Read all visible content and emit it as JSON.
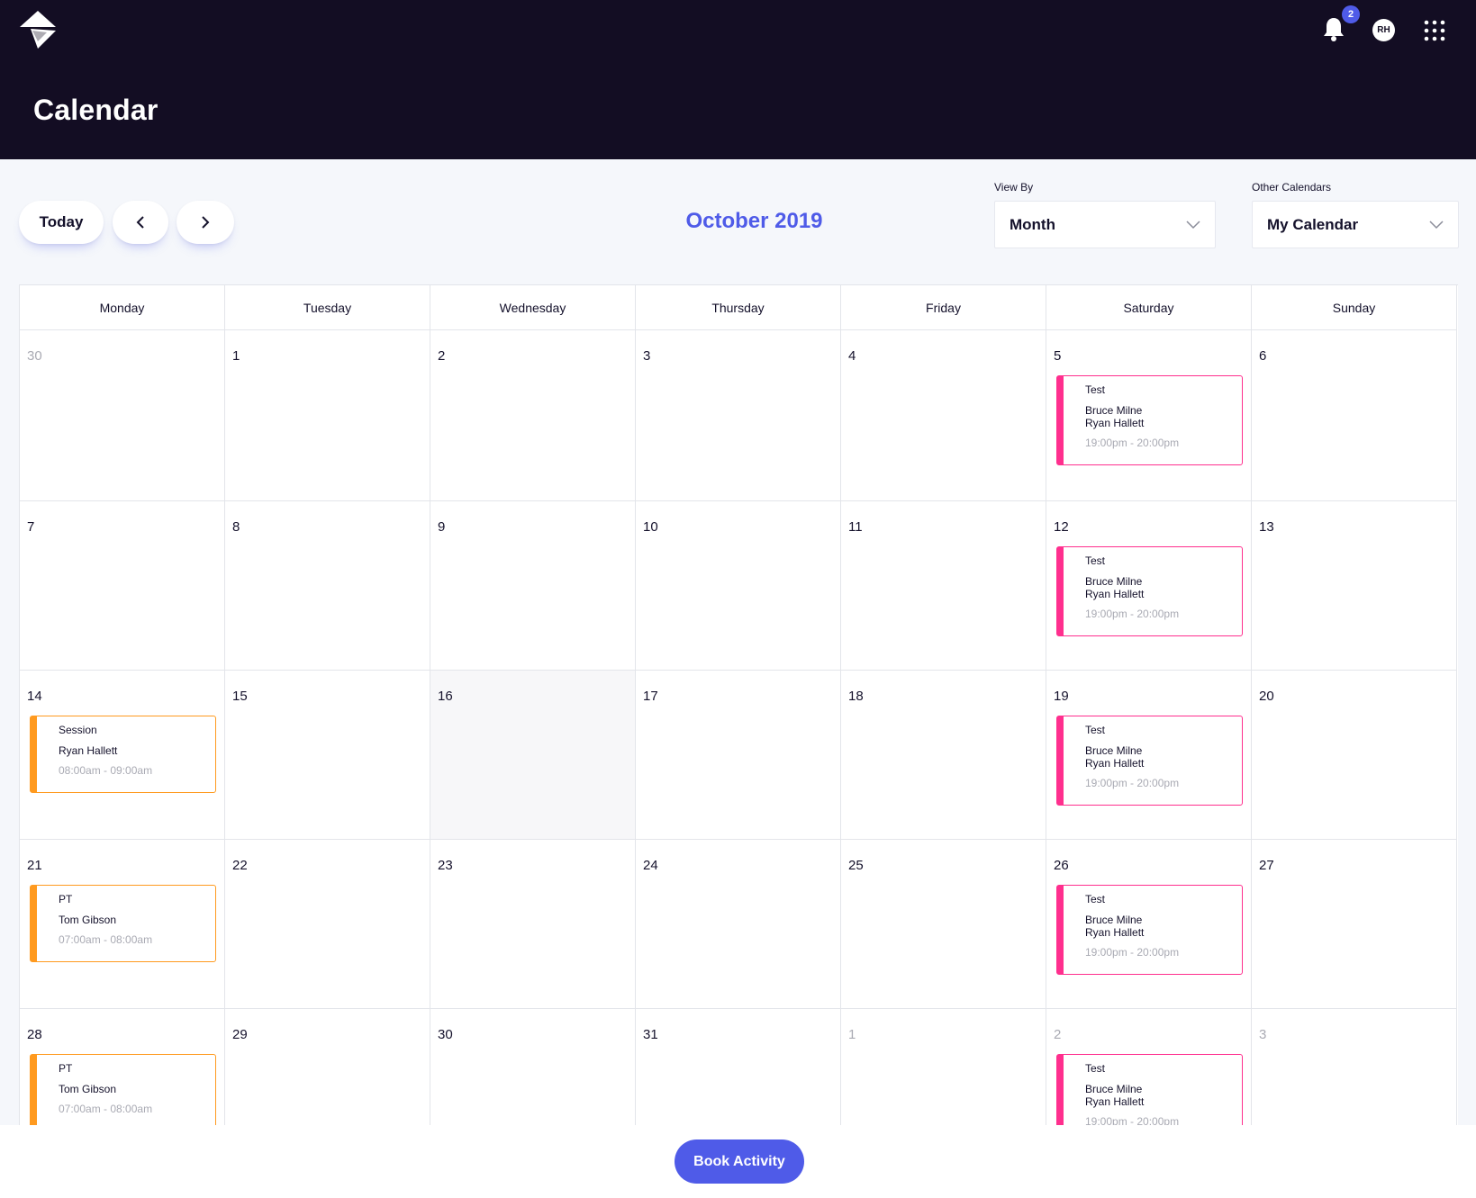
{
  "header": {
    "title": "Calendar",
    "notification_count": "2",
    "avatar_initials": "RH"
  },
  "toolbar": {
    "today_label": "Today",
    "month_title": "October 2019",
    "view_by": {
      "label": "View By",
      "value": "Month"
    },
    "other_calendars": {
      "label": "Other Calendars",
      "value": "My Calendar"
    }
  },
  "calendar": {
    "weekdays": [
      "Monday",
      "Tuesday",
      "Wednesday",
      "Thursday",
      "Friday",
      "Saturday",
      "Sunday"
    ],
    "weeks": [
      [
        {
          "day": "30",
          "muted": true
        },
        {
          "day": "1"
        },
        {
          "day": "2"
        },
        {
          "day": "3"
        },
        {
          "day": "4"
        },
        {
          "day": "5",
          "events": [
            {
              "title": "Test",
              "people": [
                "Bruce Milne",
                "Ryan Hallett"
              ],
              "time": "19:00pm - 20:00pm",
              "color": "#ff2f8e"
            }
          ]
        },
        {
          "day": "6"
        }
      ],
      [
        {
          "day": "7"
        },
        {
          "day": "8"
        },
        {
          "day": "9"
        },
        {
          "day": "10"
        },
        {
          "day": "11"
        },
        {
          "day": "12",
          "events": [
            {
              "title": "Test",
              "people": [
                "Bruce Milne",
                "Ryan Hallett"
              ],
              "time": "19:00pm - 20:00pm",
              "color": "#ff2f8e"
            }
          ]
        },
        {
          "day": "13"
        }
      ],
      [
        {
          "day": "14",
          "events": [
            {
              "title": "Session",
              "people": [
                "Ryan Hallett"
              ],
              "time": "08:00am - 09:00am",
              "color": "#ff9a1f"
            }
          ]
        },
        {
          "day": "15"
        },
        {
          "day": "16",
          "today": true
        },
        {
          "day": "17"
        },
        {
          "day": "18"
        },
        {
          "day": "19",
          "events": [
            {
              "title": "Test",
              "people": [
                "Bruce Milne",
                "Ryan Hallett"
              ],
              "time": "19:00pm - 20:00pm",
              "color": "#ff2f8e"
            }
          ]
        },
        {
          "day": "20"
        }
      ],
      [
        {
          "day": "21",
          "events": [
            {
              "title": "PT",
              "people": [
                "Tom Gibson"
              ],
              "time": "07:00am - 08:00am",
              "color": "#ff9a1f"
            }
          ]
        },
        {
          "day": "22"
        },
        {
          "day": "23"
        },
        {
          "day": "24"
        },
        {
          "day": "25"
        },
        {
          "day": "26",
          "events": [
            {
              "title": "Test",
              "people": [
                "Bruce Milne",
                "Ryan Hallett"
              ],
              "time": "19:00pm - 20:00pm",
              "color": "#ff2f8e"
            }
          ]
        },
        {
          "day": "27"
        }
      ],
      [
        {
          "day": "28",
          "events": [
            {
              "title": "PT",
              "people": [
                "Tom Gibson"
              ],
              "time": "07:00am - 08:00am",
              "color": "#ff9a1f"
            }
          ]
        },
        {
          "day": "29"
        },
        {
          "day": "30"
        },
        {
          "day": "31"
        },
        {
          "day": "1",
          "muted": true
        },
        {
          "day": "2",
          "muted": true,
          "events": [
            {
              "title": "Test",
              "people": [
                "Bruce Milne",
                "Ryan Hallett"
              ],
              "time": "19:00pm - 20:00pm",
              "color": "#ff2f8e"
            }
          ]
        },
        {
          "day": "3",
          "muted": true
        }
      ]
    ]
  },
  "footer": {
    "book_label": "Book Activity"
  },
  "colors": {
    "accent": "#4f5be8",
    "header_bg": "#130d23",
    "event_pink": "#ff2f8e",
    "event_orange": "#ff9a1f"
  }
}
